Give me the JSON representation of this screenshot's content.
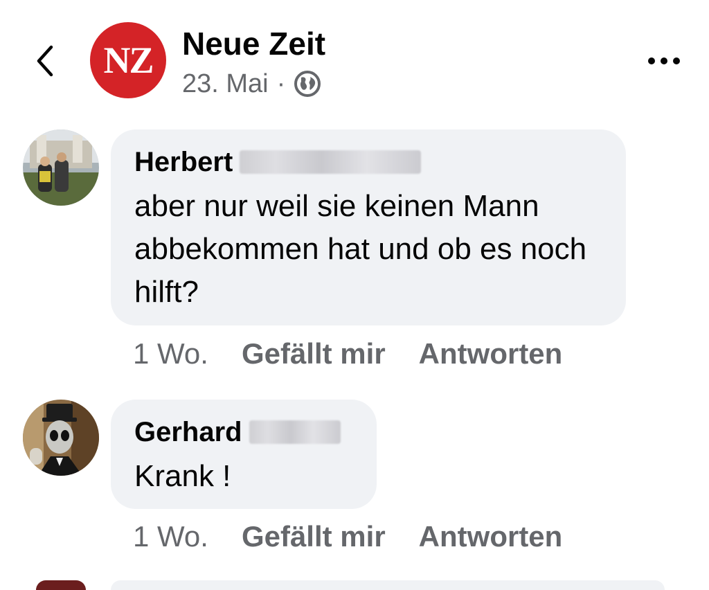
{
  "header": {
    "page_name": "Neue Zeit",
    "logo_text": "NZ",
    "date": "23. Mai",
    "separator": "·",
    "audience_icon": "globe-icon",
    "back_icon": "chevron-left-icon",
    "more_icon": "more-horizontal-icon"
  },
  "comments": [
    {
      "author": "Herbert",
      "text": "aber nur weil sie keinen Mann abbekommen hat und ob es noch hilft?",
      "time": "1 Wo.",
      "like_label": "Gefällt mir",
      "reply_label": "Antworten"
    },
    {
      "author": "Gerhard",
      "text": "Krank !",
      "time": "1 Wo.",
      "like_label": "Gefällt mir",
      "reply_label": "Antworten"
    }
  ],
  "colors": {
    "brand_red": "#d42327",
    "bubble_bg": "#f0f2f5",
    "secondary_text": "#65676b"
  }
}
